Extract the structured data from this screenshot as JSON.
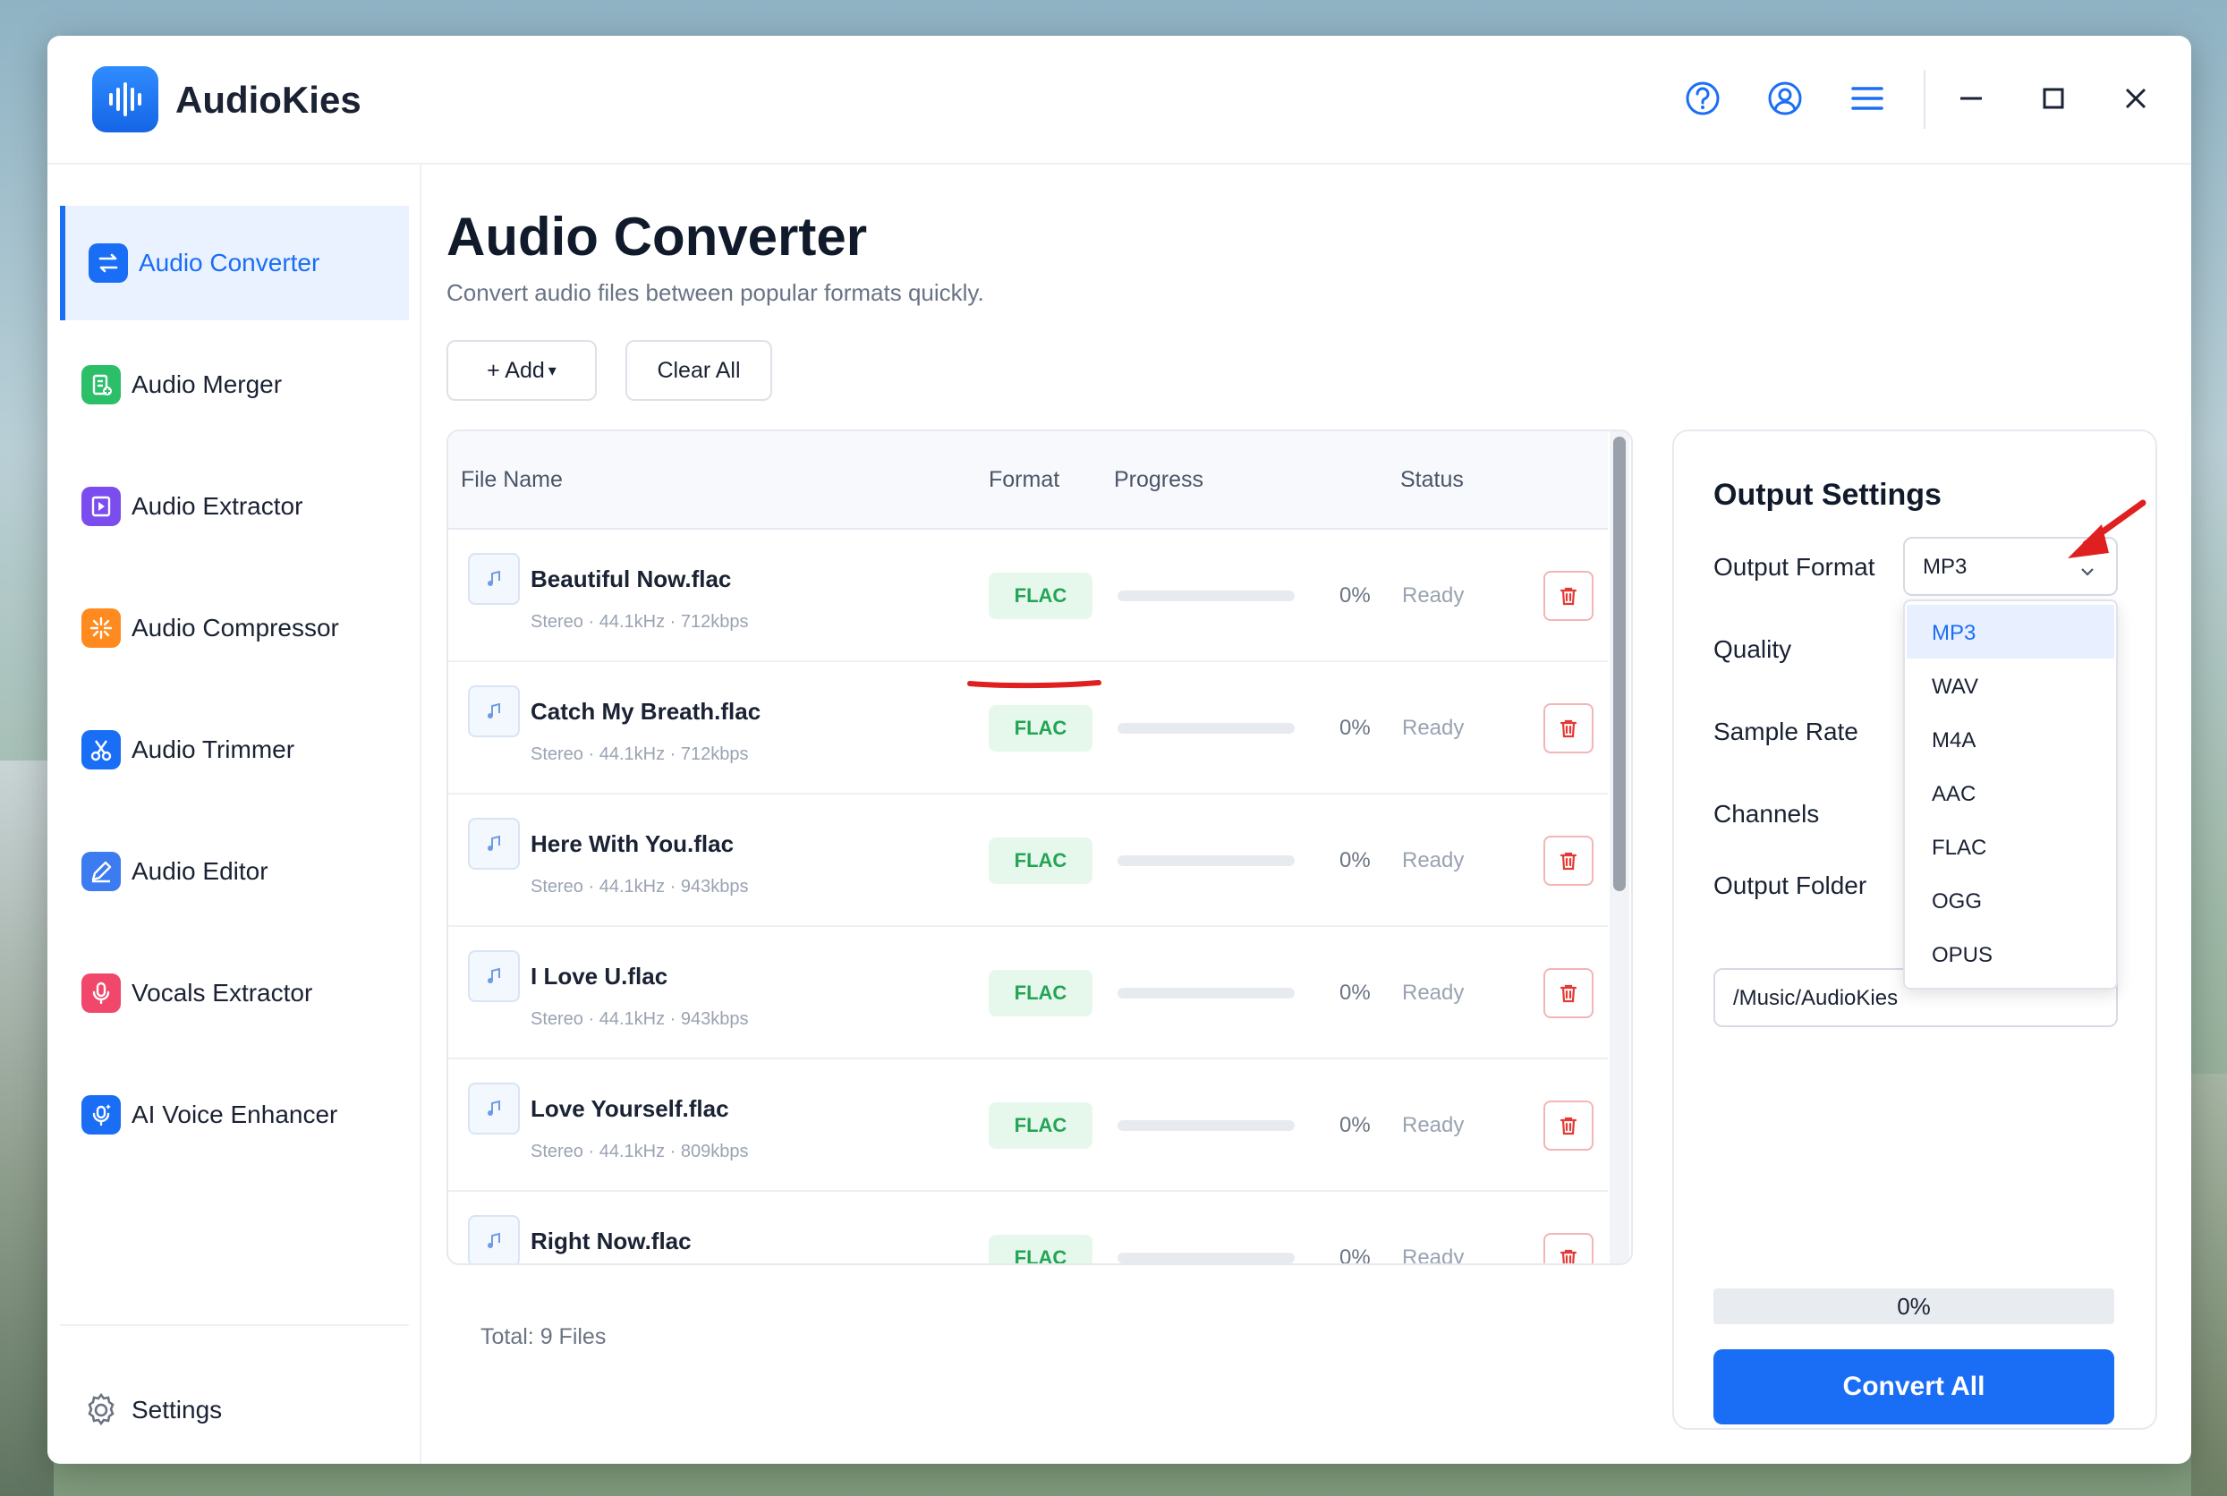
{
  "app": {
    "title": "AudioKies"
  },
  "sidebar": {
    "items": [
      {
        "label": "Audio Converter",
        "icon": "convert-icon",
        "color": "#1a6ef5"
      },
      {
        "label": "Audio Merger",
        "icon": "merge-icon",
        "color": "#2bbf6a"
      },
      {
        "label": "Audio Extractor",
        "icon": "extract-icon",
        "color": "#7b4dee"
      },
      {
        "label": "Audio Compressor",
        "icon": "compress-icon",
        "color": "#ff8a1f"
      },
      {
        "label": "Audio Trimmer",
        "icon": "scissors-icon",
        "color": "#1a6ef5"
      },
      {
        "label": "Audio Editor",
        "icon": "pencil-icon",
        "color": "#3d7bf0"
      },
      {
        "label": "Vocals Extractor",
        "icon": "microphone-icon",
        "color": "#f0476b"
      },
      {
        "label": "AI Voice Enhancer",
        "icon": "ai-mic-icon",
        "color": "#1a6ef5"
      }
    ],
    "settings_label": "Settings"
  },
  "main": {
    "title": "Audio Converter",
    "subtitle": "Convert audio files between popular formats quickly.",
    "add_label": "+ Add",
    "clear_label": "Clear All",
    "columns": {
      "file_name": "File Name",
      "format": "Format",
      "progress": "Progress",
      "status": "Status"
    },
    "files": [
      {
        "name": "Beautiful Now.flac",
        "meta": "Stereo · 44.1kHz · 712kbps",
        "format": "FLAC",
        "progress": 0,
        "pct": "0%",
        "status": "Ready"
      },
      {
        "name": "Catch My Breath.flac",
        "meta": "Stereo · 44.1kHz · 712kbps",
        "format": "FLAC",
        "progress": 0,
        "pct": "0%",
        "status": "Ready"
      },
      {
        "name": "Here With You.flac",
        "meta": "Stereo · 44.1kHz · 943kbps",
        "format": "FLAC",
        "progress": 0,
        "pct": "0%",
        "status": "Ready"
      },
      {
        "name": "I Love U.flac",
        "meta": "Stereo · 44.1kHz · 943kbps",
        "format": "FLAC",
        "progress": 0,
        "pct": "0%",
        "status": "Ready"
      },
      {
        "name": "Love Yourself.flac",
        "meta": "Stereo · 44.1kHz · 809kbps",
        "format": "FLAC",
        "progress": 0,
        "pct": "0%",
        "status": "Ready"
      },
      {
        "name": "Right Now.flac",
        "meta": "",
        "format": "FLAC",
        "progress": 0,
        "pct": "0%",
        "status": "Ready"
      }
    ],
    "total": "Total: 9 Files"
  },
  "output": {
    "title": "Output Settings",
    "format_label": "Output Format",
    "format_value": "MP3",
    "quality_label": "Quality",
    "sample_rate_label": "Sample Rate",
    "channels_label": "Channels",
    "folder_label": "Output Folder",
    "folder_value": "/Music/AudioKies",
    "format_options": [
      "MP3",
      "WAV",
      "M4A",
      "AAC",
      "FLAC",
      "OGG",
      "OPUS"
    ],
    "overall_progress": "0%",
    "convert_label": "Convert All"
  },
  "colors": {
    "accent": "#1a6ef5",
    "success": "#23a455",
    "danger": "#e53935"
  }
}
